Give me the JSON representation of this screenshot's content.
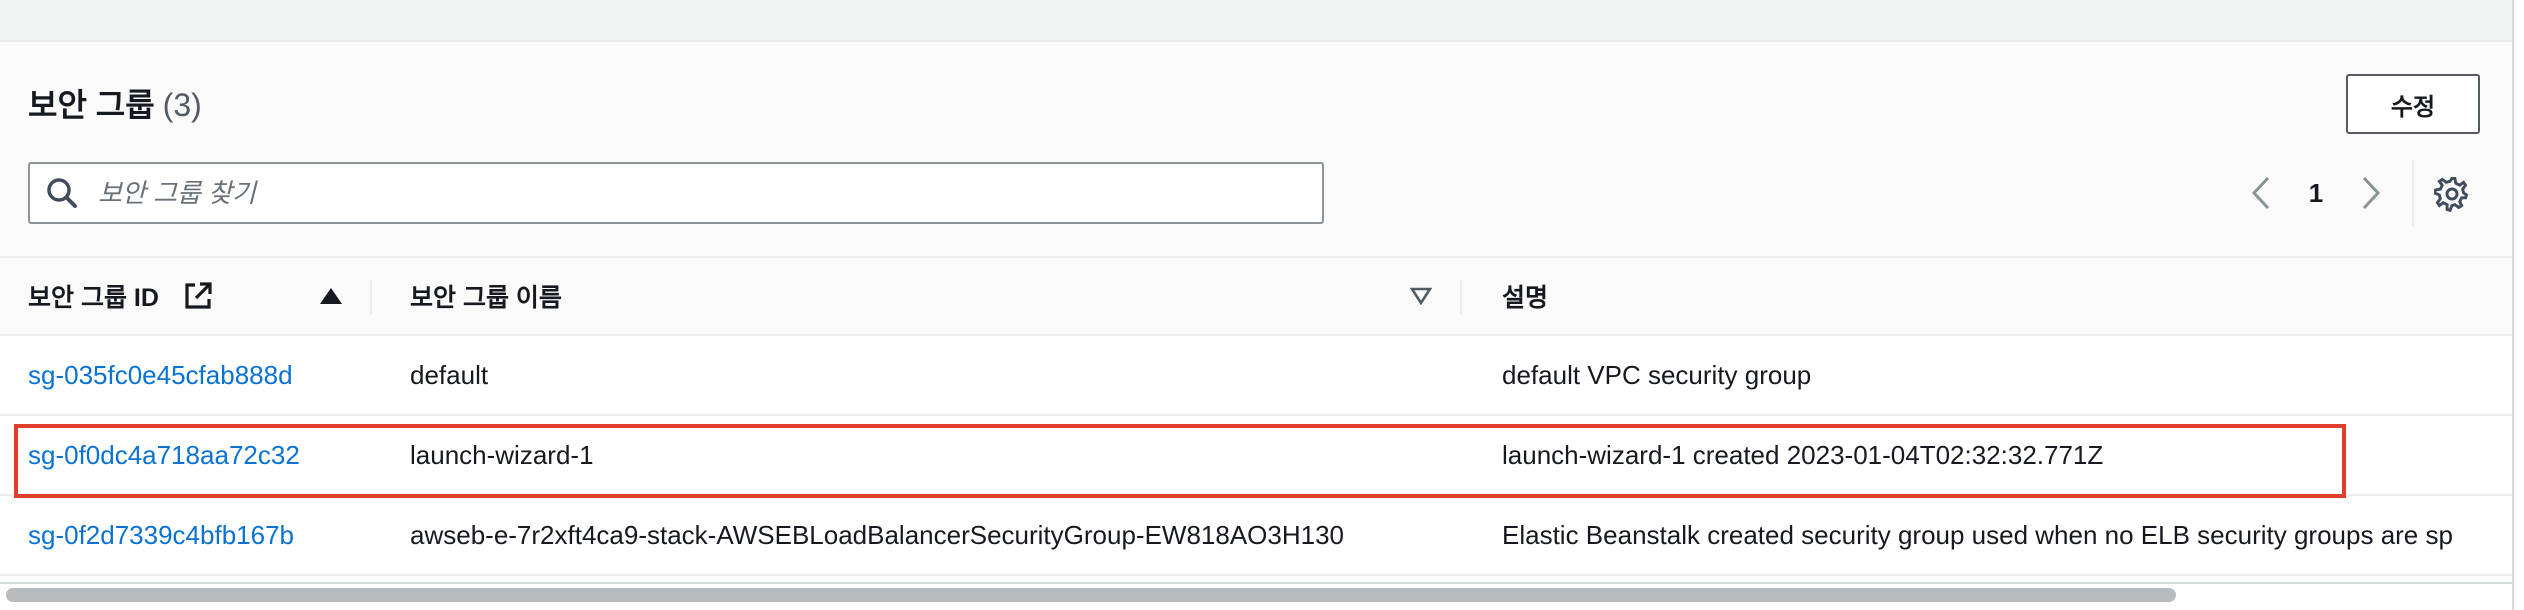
{
  "header": {
    "title": "보안 그룹",
    "count": "(3)",
    "edit_label": "수정"
  },
  "search": {
    "placeholder": "보안 그룹 찾기",
    "value": ""
  },
  "pagination": {
    "current_page": "1"
  },
  "table": {
    "columns": [
      {
        "label": "보안 그룹 ID",
        "sort": "ascending",
        "external_link_icon": "external-link-icon"
      },
      {
        "label": "보안 그룹 이름",
        "sort": "sortable"
      },
      {
        "label": "설명"
      }
    ],
    "rows": [
      {
        "id": "sg-035fc0e45cfab888d",
        "name": "default",
        "description": "default VPC security group"
      },
      {
        "id": "sg-0f0dc4a718aa72c32",
        "name": "launch-wizard-1",
        "description": "launch-wizard-1 created 2023-01-04T02:32:32.771Z",
        "highlighted": true
      },
      {
        "id": "sg-0f2d7339c4bfb167b",
        "name": "awseb-e-7r2xft4ca9-stack-AWSEBLoadBalancerSecurityGroup-EW818AO3H130",
        "description": "Elastic Beanstalk created security group used when no ELB security groups are sp"
      }
    ]
  },
  "colors": {
    "link": "#0972d3",
    "highlight_border": "#e0402b",
    "text": "#16191f"
  }
}
